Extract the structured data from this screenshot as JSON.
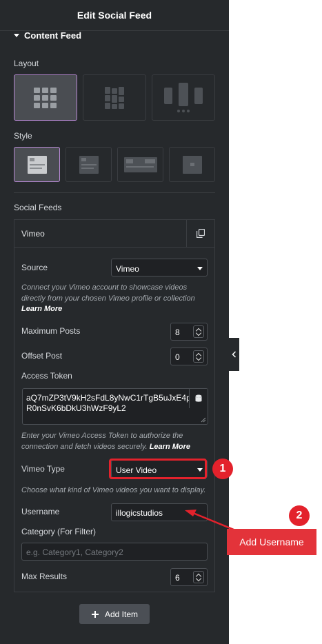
{
  "panel": {
    "title": "Edit Social Feed",
    "section_title": "Content Feed"
  },
  "layout": {
    "label": "Layout",
    "options": [
      "grid",
      "masonry",
      "carousel"
    ],
    "selected": "grid"
  },
  "style": {
    "label": "Style",
    "options": [
      "style-1",
      "style-2",
      "style-3",
      "style-4"
    ],
    "selected": "style-1"
  },
  "social_feeds": {
    "label": "Social Feeds",
    "item_title": "Vimeo",
    "source_label": "Source",
    "source_value": "Vimeo",
    "source_help": "Connect your Vimeo account to showcase videos directly from your chosen Vimeo profile or collection",
    "source_help_link": "Learn More",
    "max_posts_label": "Maximum Posts",
    "max_posts_value": "8",
    "offset_label": "Offset Post",
    "offset_value": "0",
    "token_label": "Access Token",
    "token_line1": "aQ7mZP3tV9kH2sFdL8yNwC1rTgB5uJxE4pl",
    "token_line2": "R0nSvK6bDkU3hWzF9yL2",
    "token_help": "Enter your Vimeo Access Token to authorize the connection and fetch videos securely.",
    "token_help_link": "Learn More",
    "vimeo_type_label": "Vimeo Type",
    "vimeo_type_value": "User Video",
    "vimeo_type_help": "Choose what kind of Vimeo videos you want to display.",
    "username_label": "Username",
    "username_value": "illogicstudios",
    "category_label": "Category (For Filter)",
    "category_placeholder": "e.g. Category1, Category2",
    "max_results_label": "Max Results",
    "max_results_value": "6"
  },
  "add_item_label": "Add Item",
  "annotations": {
    "badge1": "1",
    "badge2": "2",
    "callout": "Add Username",
    "color": "#e3222c"
  }
}
